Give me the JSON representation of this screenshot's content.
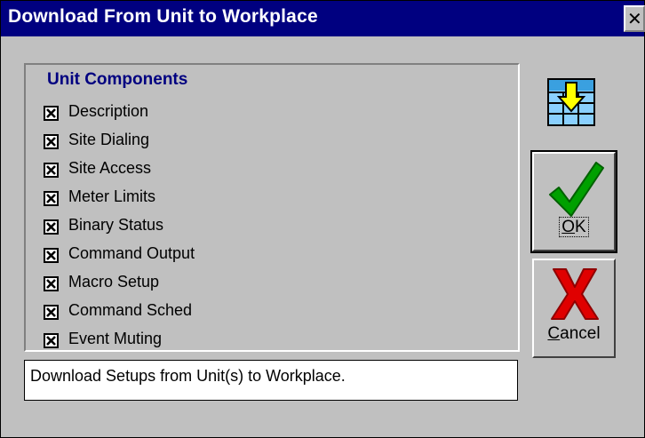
{
  "window": {
    "title": "Download From Unit to Workplace",
    "close_glyph": "✕"
  },
  "group": {
    "title": "Unit Components",
    "items": [
      {
        "label": "Description",
        "checked": true
      },
      {
        "label": "Site Dialing",
        "checked": true
      },
      {
        "label": "Site Access",
        "checked": true
      },
      {
        "label": "Meter Limits",
        "checked": true
      },
      {
        "label": "Binary Status",
        "checked": true
      },
      {
        "label": "Command Output",
        "checked": true
      },
      {
        "label": "Macro Setup",
        "checked": true
      },
      {
        "label": "Command Sched",
        "checked": true
      },
      {
        "label": "Event Muting",
        "checked": true
      }
    ]
  },
  "status_text": "Download Setups from Unit(s) to Workplace.",
  "buttons": {
    "ok": {
      "mnemonic": "O",
      "rest": "K",
      "icon": "checkmark-icon"
    },
    "cancel": {
      "mnemonic": "C",
      "rest": "ancel",
      "icon": "x-icon"
    }
  },
  "colors": {
    "titlebar": "#000080",
    "group_title": "#000080",
    "ok_green": "#00a000",
    "cancel_red": "#e00000",
    "face": "#c0c0c0"
  },
  "download_icon": "grid-download-arrow-icon"
}
